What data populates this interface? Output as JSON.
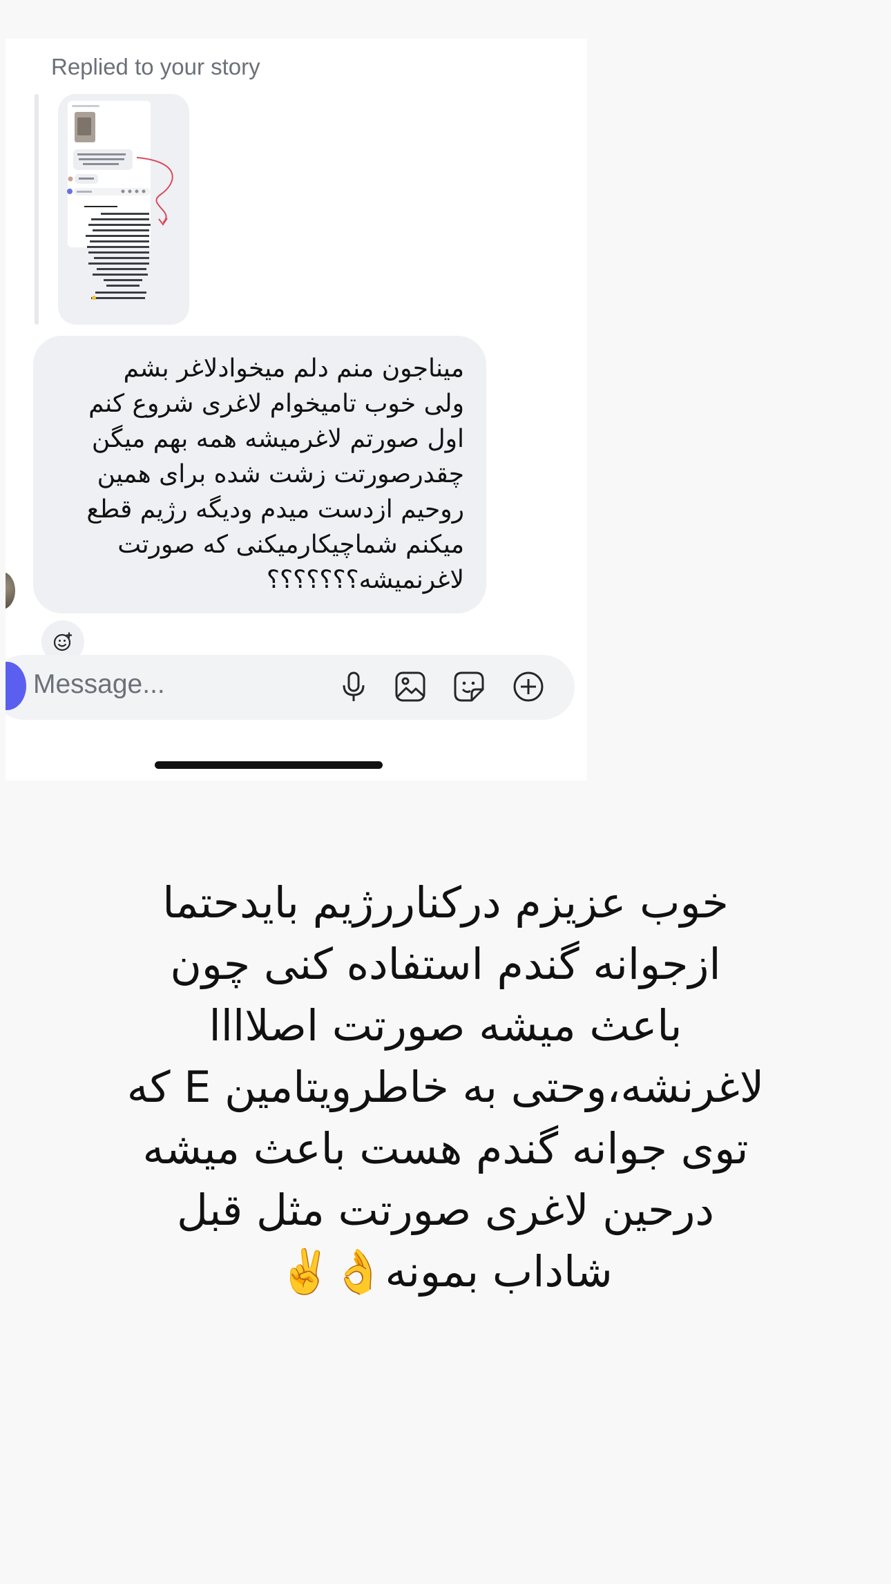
{
  "reply": {
    "label": "Replied to your story"
  },
  "message": {
    "text": "میناجون منم دلم میخوادلاغر بشم\nولی خوب تامیخوام لاغری شروع کنم\nاول صورتم لاغرمیشه همه بهم میگن\nچقدرصورتت زشت شده برای همین\nروحیم ازدست میدم ودیگه رژیم قطع\nمیکنم شماچیکارمیکنی که صورتت\nلاغرنمیشه؟؟؟؟؟؟؟"
  },
  "composer": {
    "placeholder": "Message..."
  },
  "caption": {
    "text": "خوب عزیزم درکناررژیم بایدحتما\nازجوانه گندم استفاده کنی چون\nباعث میشه صورتت اصلاااا\nلاغرنشه،وحتی به خاطرویتامین E که\nتوی جوانه گندم هست باعث میشه\nدرحین لاغری صورتت مثل قبل\nشاداب بمونه👌✌️"
  },
  "icons": {
    "react": "smiley-add-icon",
    "mic": "microphone-icon",
    "gallery": "image-icon",
    "sticker": "sticker-icon",
    "add": "plus-circle-icon",
    "camera": "camera-icon"
  },
  "colors": {
    "page_background": "#f8f8f8",
    "bubble": "#eff0f3",
    "camera_button": "#5b5ff0",
    "secondary_text": "#6b7079"
  }
}
